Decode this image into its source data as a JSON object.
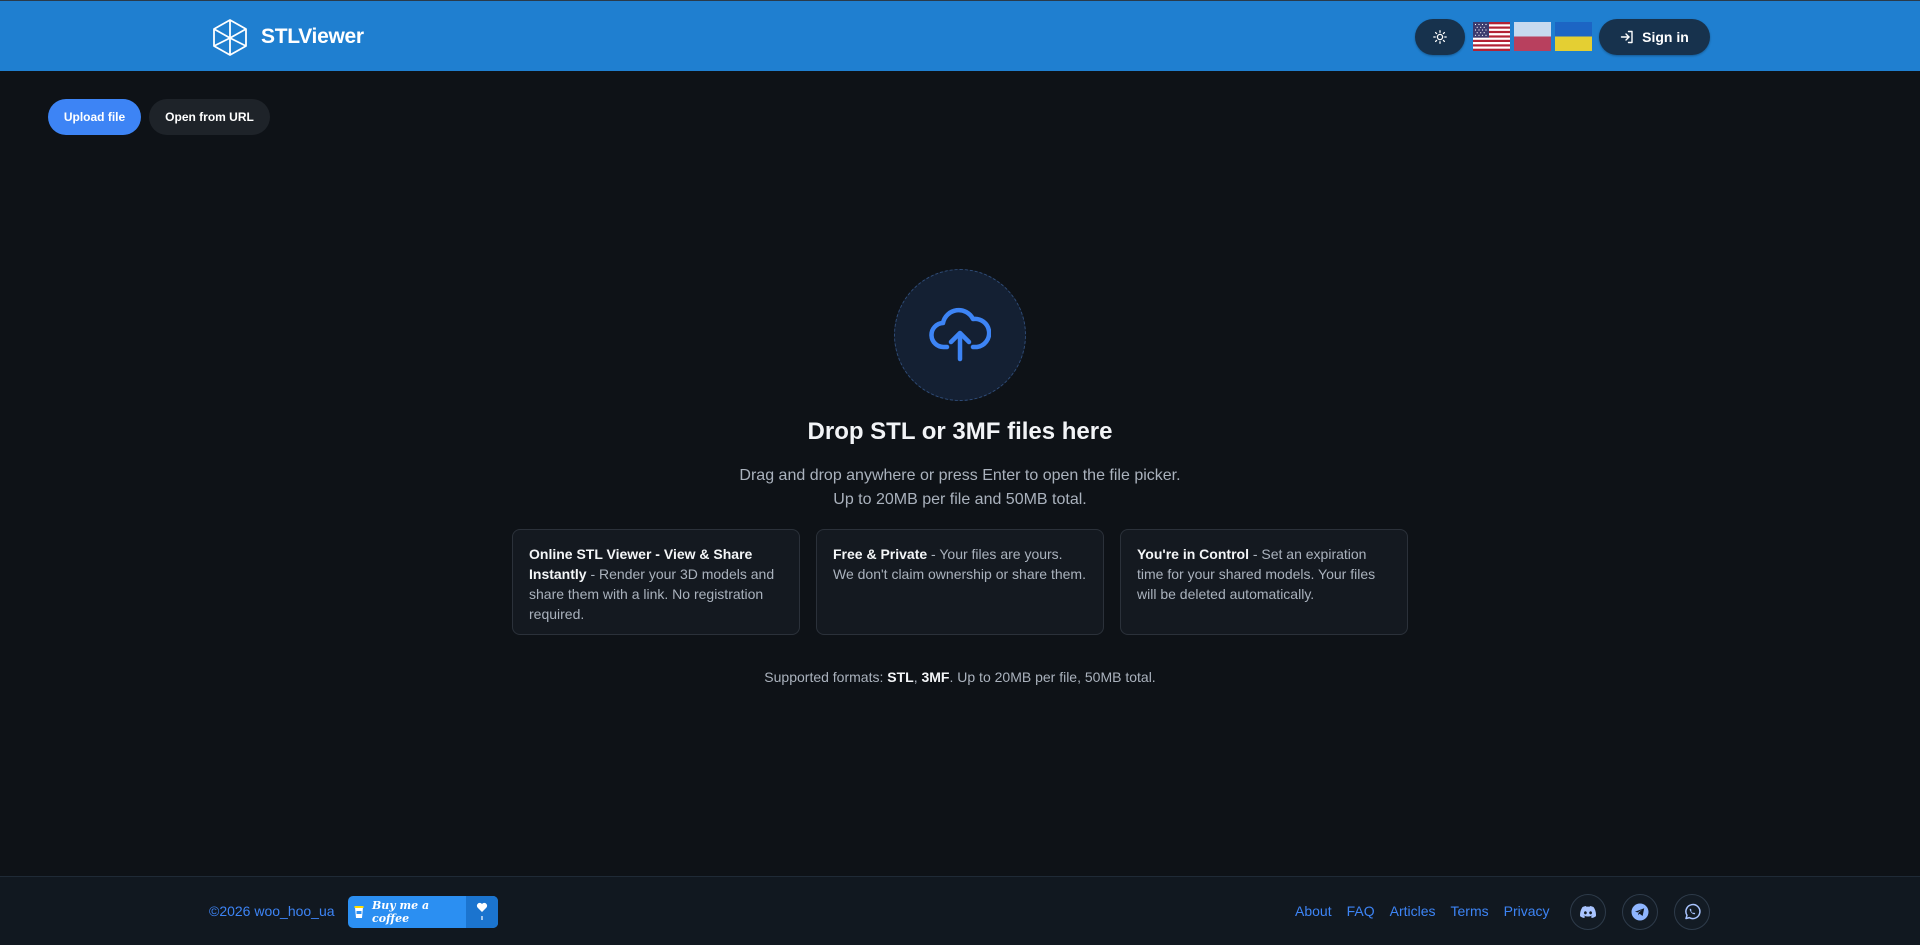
{
  "header": {
    "brand": "STLViewer",
    "theme_icon": "sun-icon",
    "languages": [
      "English",
      "Polski",
      "Українська"
    ],
    "sign_in": "Sign in",
    "colors": {
      "bar": "#1f7fd0",
      "button": "#17324d"
    }
  },
  "toolbar": {
    "upload": "Upload file",
    "open_url": "Open from URL"
  },
  "dropzone": {
    "icon": "upload-cloud-icon",
    "title": "Drop STL or 3MF files here",
    "subtitle1": "Drag and drop anywhere or press Enter to open the file picker.",
    "subtitle2": "Up to 20MB per file and 50MB total."
  },
  "features": [
    {
      "title": "Online STL Viewer - View & Share Instantly",
      "text": " - Render your 3D models and share them with a link. No registration required."
    },
    {
      "title": "Free & Private",
      "text": " - Your files are yours. We don't claim ownership or share them."
    },
    {
      "title": "You're in Control",
      "text": " - Set an expiration time for your shared models. Your files will be deleted automatically."
    }
  ],
  "formats": {
    "prefix": "Supported formats: ",
    "f1": "STL",
    "sep": ", ",
    "f2": "3MF",
    "suffix": ". Up to 20MB per file, 50MB total."
  },
  "footer": {
    "copyright": "©2026 woo_hoo_ua",
    "coffee": "Buy me a coffee",
    "links": [
      "About",
      "FAQ",
      "Articles",
      "Terms",
      "Privacy"
    ],
    "social": [
      "discord-icon",
      "telegram-icon",
      "whatsapp-icon"
    ],
    "accent": "#3d84f5"
  }
}
